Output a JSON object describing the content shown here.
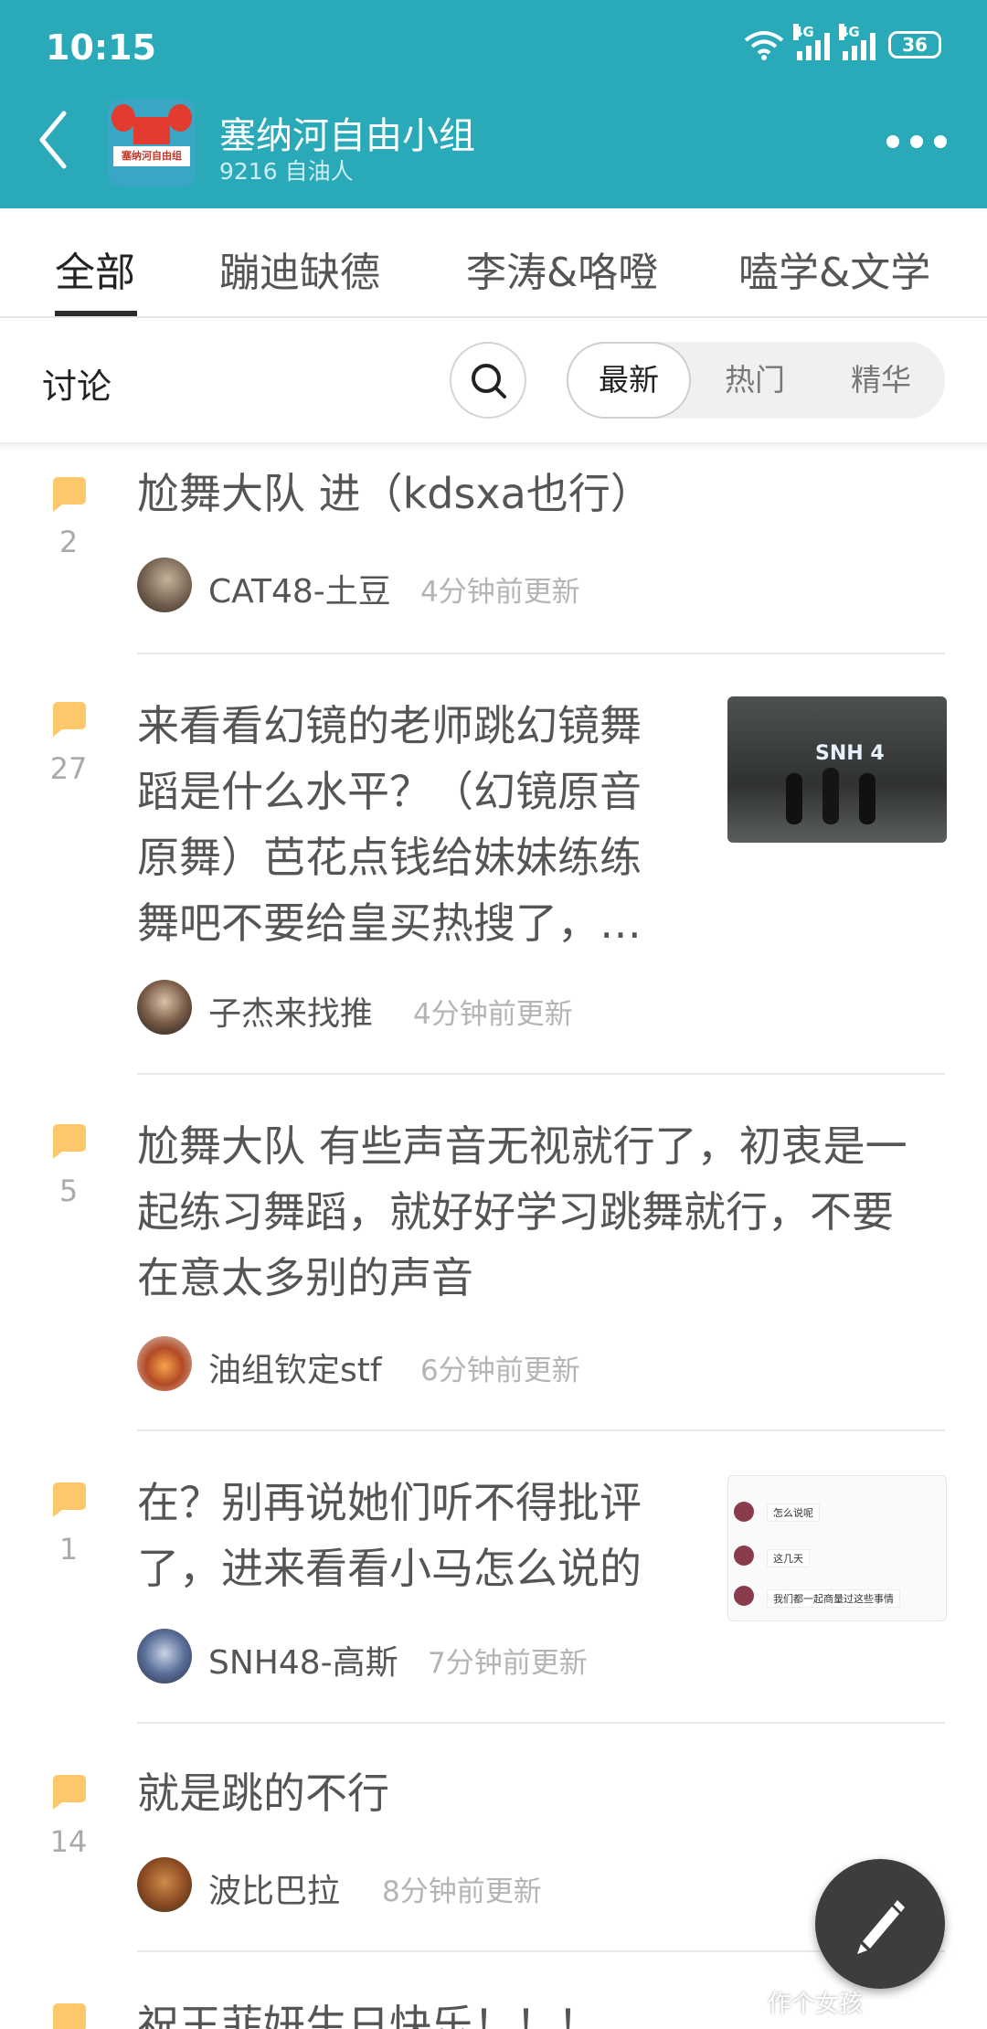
{
  "status_bar": {
    "time": "10:15",
    "network_1": "4G",
    "network_2": "4G",
    "battery": "36"
  },
  "group": {
    "name": "塞纳河自由小组",
    "members": "9216 自油人",
    "logo_text": "塞纳河自由组"
  },
  "tabs": [
    {
      "label": "全部",
      "active": true
    },
    {
      "label": "蹦迪缺德",
      "active": false
    },
    {
      "label": "李涛&咯噔",
      "active": false
    },
    {
      "label": "嗑学&文学",
      "active": false
    }
  ],
  "filter": {
    "title": "讨论",
    "sorts": [
      "最新",
      "热门",
      "精华"
    ],
    "active_sort": "最新"
  },
  "posts": [
    {
      "count": "2",
      "title": "尬舞大队 进（kdsxa也行）",
      "author": "CAT48-土豆",
      "time": "4分钟前更新"
    },
    {
      "count": "27",
      "title_lines": [
        "来看看幻镜的老师跳幻镜舞",
        "蹈是什么水平？（幻镜原音",
        "原舞）芭花点钱给妹妹练练",
        "舞吧不要给皇买热搜了，…"
      ],
      "author": "子杰来找推",
      "time": "4分钟前更新",
      "thumb_text": "SNH 4"
    },
    {
      "count": "5",
      "title_lines": [
        "尬舞大队 有些声音无视就行了，初衷是一",
        "起练习舞蹈，就好好学习跳舞就行，不要",
        "在意太多别的声音"
      ],
      "author": "油组钦定stf",
      "time": "6分钟前更新"
    },
    {
      "count": "1",
      "title_lines": [
        "在？别再说她们听不得批评",
        "了，进来看看小马怎么说的"
      ],
      "author": "SNH48-高斯",
      "time": "7分钟前更新",
      "thumb_lines": [
        "怎么说呢",
        "这几天",
        "我们都一起商量过这些事情"
      ]
    },
    {
      "count": "14",
      "title": "就是跳的不行",
      "author": "波比巴拉",
      "time": "8分钟前更新"
    },
    {
      "title": "祝王菲妍生日快乐！！！"
    }
  ],
  "watermark": "作个女孩",
  "colors": {
    "header": "#2aaab9",
    "flag": "#fcc86a",
    "fab": "#3d3d3d"
  },
  "icons": {
    "back": "chevron-left-icon",
    "more": "more-dots-icon",
    "search": "search-icon",
    "flag": "comment-flag-icon",
    "fab": "pencil-icon"
  }
}
